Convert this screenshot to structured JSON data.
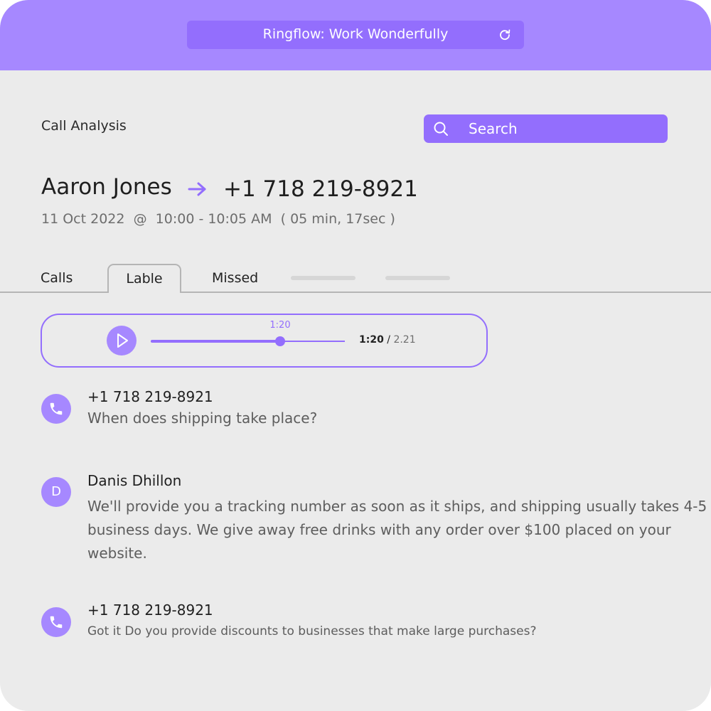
{
  "browser": {
    "title": "Ringflow: Work Wonderfully",
    "reload_icon": "reload-icon"
  },
  "header": {
    "section_title": "Call Analysis",
    "search_label": "Search"
  },
  "call": {
    "caller_name": "Aaron Jones",
    "caller_phone": "+1 718 219-8921",
    "date": "11 Oct 2022",
    "at": "@",
    "time_range": "10:00 - 10:05 AM",
    "duration": "( 05 min, 17sec )"
  },
  "tabs": [
    {
      "label": "Calls",
      "active": false
    },
    {
      "label": "Lable",
      "active": true
    },
    {
      "label": "Missed",
      "active": false
    }
  ],
  "player": {
    "tooltip": "1:20",
    "current": "1:20",
    "separator": " / ",
    "total": "2.21",
    "progress_fraction": 0.665
  },
  "transcript": [
    {
      "avatar": "phone-icon",
      "name": "+1 718 219-8921",
      "text": "When does shipping take place?"
    },
    {
      "avatar": "D",
      "name": "Danis Dhillon",
      "text": "We'll provide you a tracking number as soon as it ships, and shipping usually takes 4-5 business days. We give away free drinks with any order over $100 placed on your website."
    },
    {
      "avatar": "phone-icon",
      "name": "+1 718 219-8921",
      "text": "Got it Do you provide discounts to businesses that make large purchases?"
    }
  ],
  "colors": {
    "accent": "#936efd",
    "accent_light": "#a688ff",
    "background": "#ebebeb"
  }
}
